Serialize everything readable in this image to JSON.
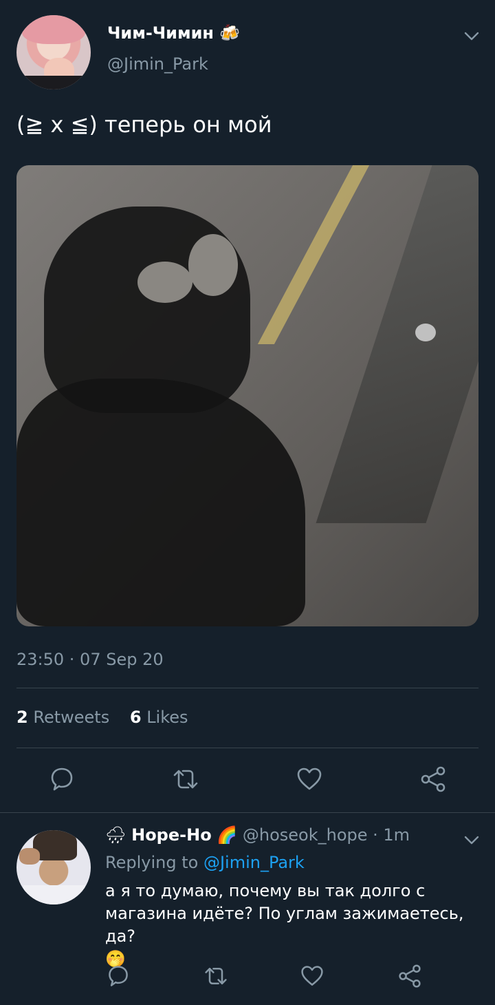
{
  "tweet": {
    "display_name": "Чим-Чимин",
    "name_emoji": "🍻",
    "handle": "@Jimin_Park",
    "text": "(≧ x ≦) теперь он мой",
    "timestamp": "23:50 · 07 Sep 20",
    "retweets_count": "2",
    "retweets_label": "Retweets",
    "likes_count": "6",
    "likes_label": "Likes"
  },
  "reply": {
    "prefix_emoji": "🌧",
    "display_name": "Hope-Ho",
    "name_emoji": "🌈",
    "handle_time": "@hoseok_hope · 1m",
    "replying_label": "Replying to",
    "replying_to": "@Jimin_Park",
    "text": "а я то думаю, почему вы так долго с магазина идёте? По углам зажимаетесь, да?",
    "text_emoji": "🤭"
  },
  "icons": {
    "reply": "speech-bubble-icon",
    "retweet": "retweet-icon",
    "like": "heart-icon",
    "share": "share-icon",
    "more": "chevron-down-icon"
  },
  "colors": {
    "background": "#15202b",
    "secondary_text": "#8899a6",
    "divider": "#38444d",
    "link": "#1da1f2"
  }
}
